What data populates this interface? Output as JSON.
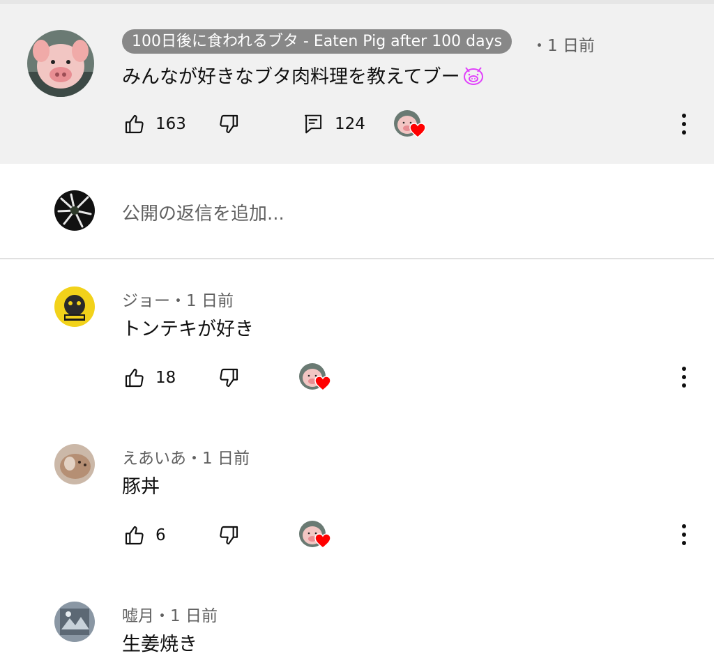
{
  "pinned": {
    "author": "100日後に食われるブタ - Eaten Pig after 100 days",
    "time": "・1 日前",
    "text": "みんなが好きなブタ肉料理を教えてブー",
    "likes": "163",
    "replies": "124"
  },
  "reply_box": {
    "placeholder": "公開の返信を追加..."
  },
  "comments": [
    {
      "author": "ジョー",
      "time": "・1 日前",
      "text": "トンテキが好き",
      "likes": "18"
    },
    {
      "author": "えあいあ",
      "time": "・1 日前",
      "text": "豚丼",
      "likes": "6"
    },
    {
      "author": "嘘月",
      "time": "・1 日前",
      "text": "生姜焼き"
    }
  ],
  "icons": {
    "like": "thumb-up-icon",
    "dislike": "thumb-down-icon",
    "reply": "comment-icon",
    "more": "more-vert-icon",
    "heart": "creator-heart-icon",
    "emoji": "pig-face-emoji"
  },
  "colors": {
    "heart": "#ff0000",
    "pinned_bg": "#f1f1f1",
    "badge_bg": "#888888",
    "emoji": "#e040fb"
  }
}
